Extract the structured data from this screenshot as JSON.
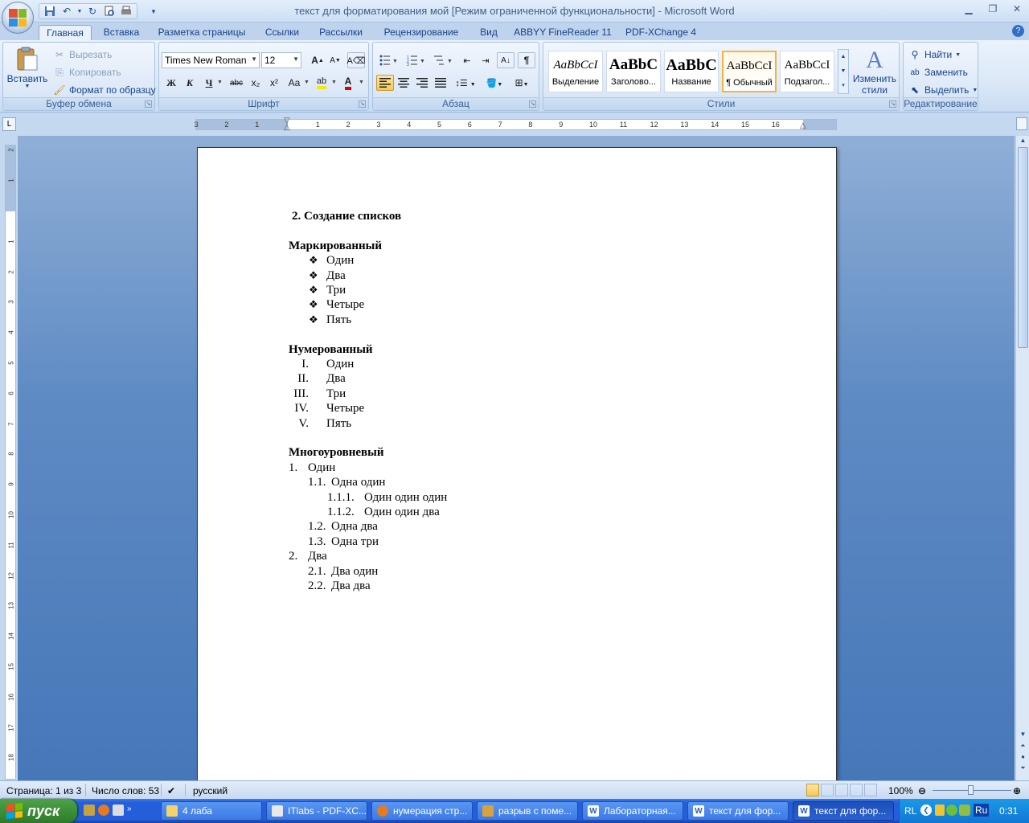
{
  "window": {
    "title": "текст для форматирования мой [Режим ограниченной функциональности] - Microsoft Word",
    "controls": [
      "minimize-icon",
      "restore-icon",
      "close-icon"
    ]
  },
  "quick_access": [
    "save-icon",
    "undo-icon",
    "redo-icon",
    "print-preview-icon",
    "quick-print-icon",
    "customize-icon"
  ],
  "tabs": [
    "Главная",
    "Вставка",
    "Разметка страницы",
    "Ссылки",
    "Рассылки",
    "Рецензирование",
    "Вид",
    "ABBYY FineReader 11",
    "PDF-XChange 4"
  ],
  "active_tab": "Главная",
  "clipboard": {
    "label": "Буфер обмена",
    "paste": "Вставить",
    "cut": "Вырезать",
    "copy": "Копировать",
    "format_painter": "Формат по образцу"
  },
  "font": {
    "label": "Шрифт",
    "family": "Times New Roman",
    "size": "12",
    "buttons": [
      "Ж",
      "К",
      "Ч",
      "abc",
      "x₂",
      "x²",
      "Aa"
    ],
    "highlight_color": "#f5e90a",
    "font_color": "#e00000"
  },
  "paragraph": {
    "label": "Абзац"
  },
  "styles": {
    "label": "Стили",
    "items": [
      {
        "sample": "AaBbCcI",
        "name": "Выделение"
      },
      {
        "sample": "AaBbC",
        "name": "Заголово..."
      },
      {
        "sample": "AaBbC",
        "name": "Название"
      },
      {
        "sample": "AaBbCcI",
        "name": "¶ Обычный"
      },
      {
        "sample": "AaBbCcI",
        "name": "Подзагол..."
      }
    ],
    "change_styles_line1": "Изменить",
    "change_styles_line2": "стили"
  },
  "editing": {
    "label": "Редактирование",
    "find": "Найти",
    "replace": "Заменить",
    "select": "Выделить"
  },
  "ruler": {
    "h_labels": [
      "3",
      "2",
      "1",
      "1",
      "2",
      "3",
      "4",
      "5",
      "6",
      "7",
      "8",
      "9",
      "10",
      "11",
      "12",
      "13",
      "14",
      "15",
      "16"
    ],
    "v_labels": [
      "2",
      "1",
      "1",
      "2",
      "3",
      "4",
      "5",
      "6",
      "7",
      "8",
      "9",
      "10",
      "11",
      "12",
      "13",
      "14",
      "15",
      "16",
      "17",
      "18"
    ]
  },
  "document": {
    "heading": "2.   Создание списков",
    "bulleted_title": "Маркированный",
    "bulleted": [
      "Один",
      "Два",
      "Три",
      "Четыре",
      "Пять"
    ],
    "numbered_title": "Нумерованный",
    "numbered": [
      {
        "num": "I.",
        "text": "Один"
      },
      {
        "num": "II.",
        "text": "Два"
      },
      {
        "num": "III.",
        "text": "Три"
      },
      {
        "num": "IV.",
        "text": "Четыре"
      },
      {
        "num": "V.",
        "text": "Пять"
      }
    ],
    "multilevel_title": "Многоуровневый",
    "multilevel": [
      {
        "num": "1.",
        "text": "Один",
        "level": 0
      },
      {
        "num": "1.1.",
        "text": "Одна один",
        "level": 1
      },
      {
        "num": "1.1.1.",
        "text": "Один один один",
        "level": 2
      },
      {
        "num": "1.1.2.",
        "text": "Один один два",
        "level": 2
      },
      {
        "num": "1.2.",
        "text": "Одна два",
        "level": 1
      },
      {
        "num": "1.3.",
        "text": "Одна три",
        "level": 1
      },
      {
        "num": "2.",
        "text": "Два",
        "level": 0
      },
      {
        "num": "2.1.",
        "text": "Два один",
        "level": 1
      },
      {
        "num": "2.2.",
        "text": "Два два",
        "level": 1
      }
    ]
  },
  "status": {
    "page": "Страница: 1 из 3",
    "words": "Число слов: 53",
    "language": "русский",
    "zoom": "100%"
  },
  "taskbar": {
    "start": "пуск",
    "items": [
      {
        "label": "4 лаба",
        "icon": "folder-icon",
        "active": false
      },
      {
        "label": "ITlabs - PDF-XC...",
        "icon": "pdf-icon",
        "active": false
      },
      {
        "label": "нумерация стр...",
        "icon": "firefox-icon",
        "active": false
      },
      {
        "label": "разрыв с поме...",
        "icon": "trophy-icon",
        "active": false
      },
      {
        "label": "Лабораторная...",
        "icon": "word-icon",
        "active": false
      },
      {
        "label": "текст для фор...",
        "icon": "word-icon",
        "active": false
      },
      {
        "label": "текст для фор...",
        "icon": "word-icon",
        "active": true
      }
    ],
    "tray_lang": "RL",
    "tray_kb": "Ru",
    "clock": "0:31"
  }
}
